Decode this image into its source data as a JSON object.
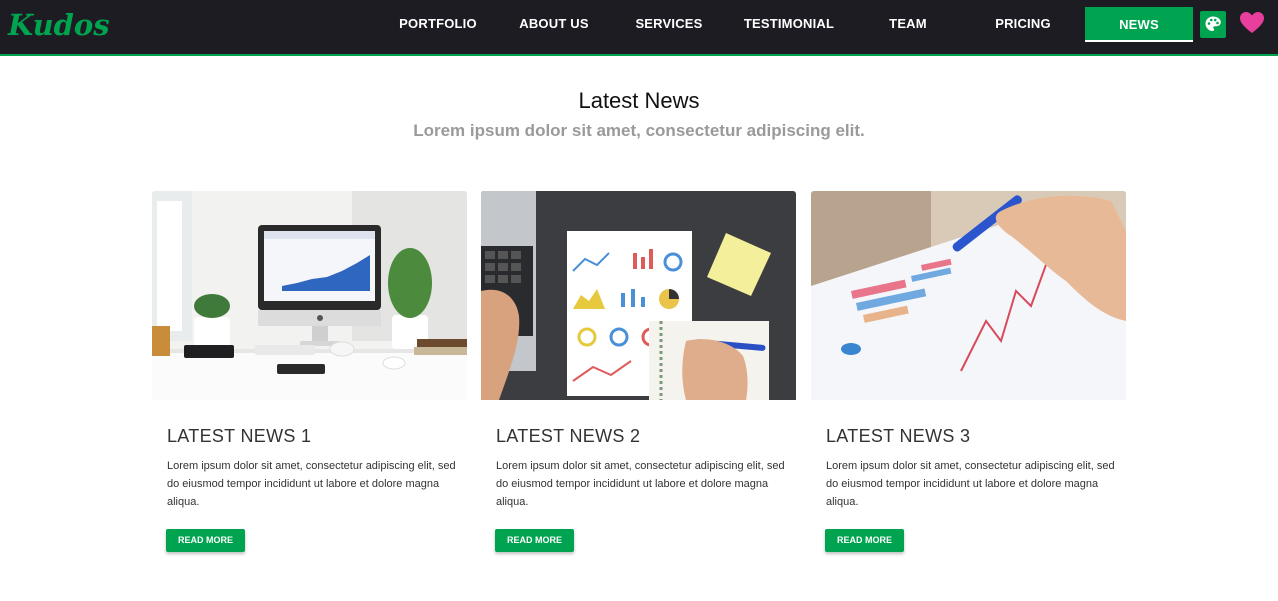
{
  "brand": {
    "logo": "Kudos",
    "accent": "#00a34f"
  },
  "nav": {
    "items": [
      {
        "label": "PORTFOLIO"
      },
      {
        "label": "ABOUT US"
      },
      {
        "label": "SERVICES"
      },
      {
        "label": "TESTIMONIAL"
      },
      {
        "label": "TEAM"
      },
      {
        "label": "PRICING"
      },
      {
        "label": "NEWS",
        "active": true
      }
    ],
    "icons": [
      "palette-icon",
      "heart-icon"
    ]
  },
  "section": {
    "title": "Latest News",
    "subtitle": "Lorem ipsum dolor sit amet, consectetur adipiscing elit."
  },
  "cards": [
    {
      "title": "LATEST NEWS 1",
      "text": "Lorem ipsum dolor sit amet, consectetur adipiscing elit, sed do eiusmod tempor incididunt ut labore et dolore magna aliqua.",
      "button": "READ MORE",
      "image": "desk-computer-photo"
    },
    {
      "title": "LATEST NEWS 2",
      "text": "Lorem ipsum dolor sit amet, consectetur adipiscing elit, sed do eiusmod tempor incididunt ut labore et dolore magna aliqua.",
      "button": "READ MORE",
      "image": "charts-notebook-photo"
    },
    {
      "title": "LATEST NEWS 3",
      "text": "Lorem ipsum dolor sit amet, consectetur adipiscing elit, sed do eiusmod tempor incididunt ut labore et dolore magna aliqua.",
      "button": "READ MORE",
      "image": "pen-chart-photo"
    }
  ]
}
